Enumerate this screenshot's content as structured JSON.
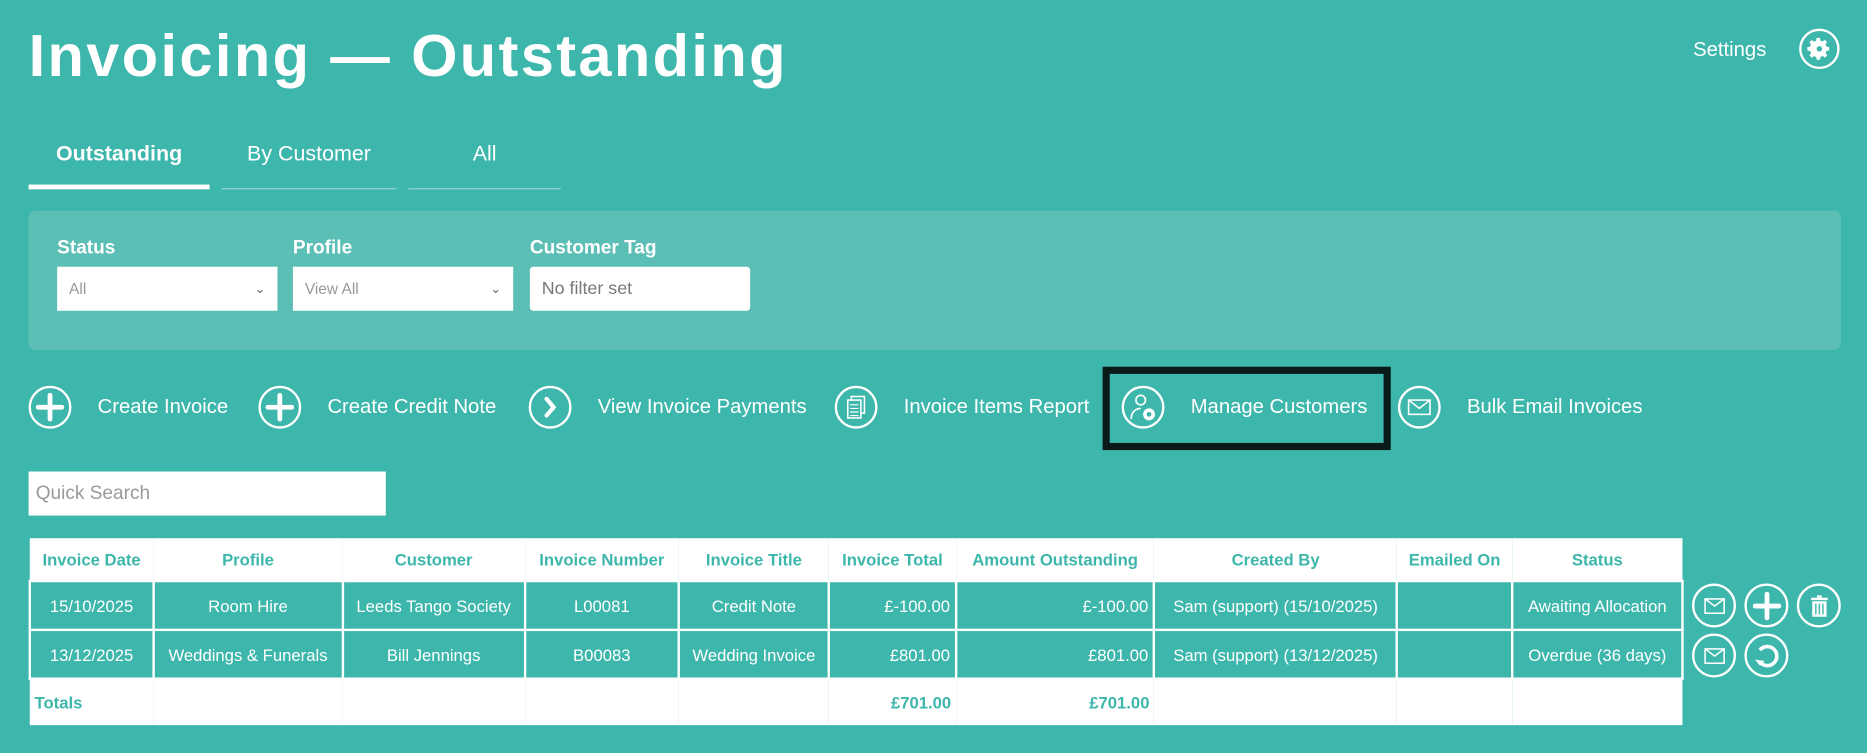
{
  "header": {
    "title": "Invoicing — Outstanding",
    "settings_label": "Settings"
  },
  "tabs": [
    {
      "label": "Outstanding",
      "active": true
    },
    {
      "label": "By Customer"
    },
    {
      "label": "All"
    }
  ],
  "filters": {
    "status": {
      "label": "Status",
      "value": "All"
    },
    "profile": {
      "label": "Profile",
      "value": "View All"
    },
    "customer_tag": {
      "label": "Customer Tag",
      "placeholder": "No filter set"
    }
  },
  "actions": [
    {
      "label": "Create Invoice",
      "icon": "plus-icon"
    },
    {
      "label": "Create Credit Note",
      "icon": "plus-icon"
    },
    {
      "label": "View Invoice Payments",
      "icon": "chevron-right-icon"
    },
    {
      "label": "Invoice Items Report",
      "icon": "document-icon"
    },
    {
      "label": "Manage Customers",
      "icon": "user-gear-icon"
    },
    {
      "label": "Bulk Email Invoices",
      "icon": "envelope-icon"
    }
  ],
  "search": {
    "placeholder": "Quick Search"
  },
  "table": {
    "columns": [
      "Invoice Date",
      "Profile",
      "Customer",
      "Invoice Number",
      "Invoice Title",
      "Invoice Total",
      "Amount Outstanding",
      "Created By",
      "Emailed On",
      "Status"
    ],
    "rows": [
      [
        "15/10/2025",
        "Room Hire",
        "Leeds Tango Society",
        "L00081",
        "Credit Note",
        "£-100.00",
        "£-100.00",
        "Sam (support) (15/10/2025)",
        "",
        "Awaiting Allocation"
      ],
      [
        "13/12/2025",
        "Weddings & Funerals",
        "Bill Jennings",
        "B00083",
        "Wedding Invoice",
        "£801.00",
        "£801.00",
        "Sam (support) (13/12/2025)",
        "",
        "Overdue (36 days)"
      ]
    ],
    "totals": {
      "label": "Totals",
      "invoice_total": "£701.00",
      "amount_outstanding": "£701.00"
    }
  },
  "colors": {
    "background": "#3db6ab",
    "panel": "#5cbfb5",
    "highlight": "#0a1a18"
  }
}
